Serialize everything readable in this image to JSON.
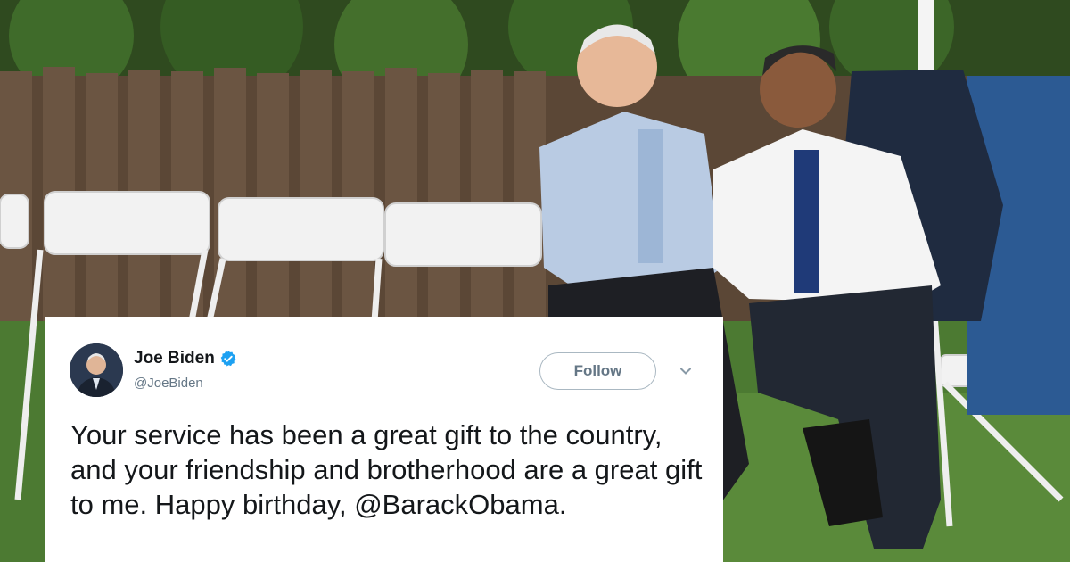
{
  "tweet": {
    "author_name": "Joe Biden",
    "author_handle": "@JoeBiden",
    "verified": true,
    "follow_label": "Follow",
    "text": "Your service has been a great gift to the country, and your friendship and brotherhood are a great gift to me. Happy birthday, ",
    "mention": "@BarackObama",
    "text_end": ".",
    "accent_color": "#1da1f2"
  },
  "icons": {
    "verified": "verified-badge-icon",
    "menu": "chevron-down-icon"
  }
}
